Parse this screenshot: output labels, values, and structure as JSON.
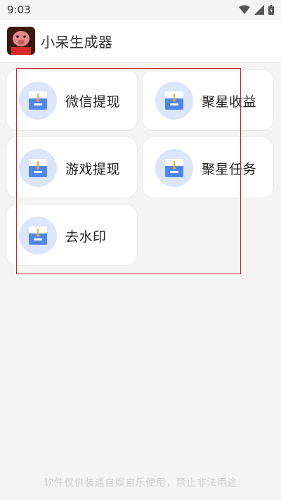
{
  "status_bar": {
    "time": "9:03"
  },
  "app": {
    "title": "小呆生成器"
  },
  "menu": [
    {
      "label": "微信提现"
    },
    {
      "label": "聚星收益"
    },
    {
      "label": "游戏提现"
    },
    {
      "label": "聚星任务"
    },
    {
      "label": "去水印"
    }
  ],
  "footer": {
    "notice": "软件仅供装逼自娱自乐使用，禁止非法用途"
  },
  "colors": {
    "icon_bg": "#dbe6fb",
    "icon_blue": "#4f86ee",
    "selection": "#d2232a"
  }
}
